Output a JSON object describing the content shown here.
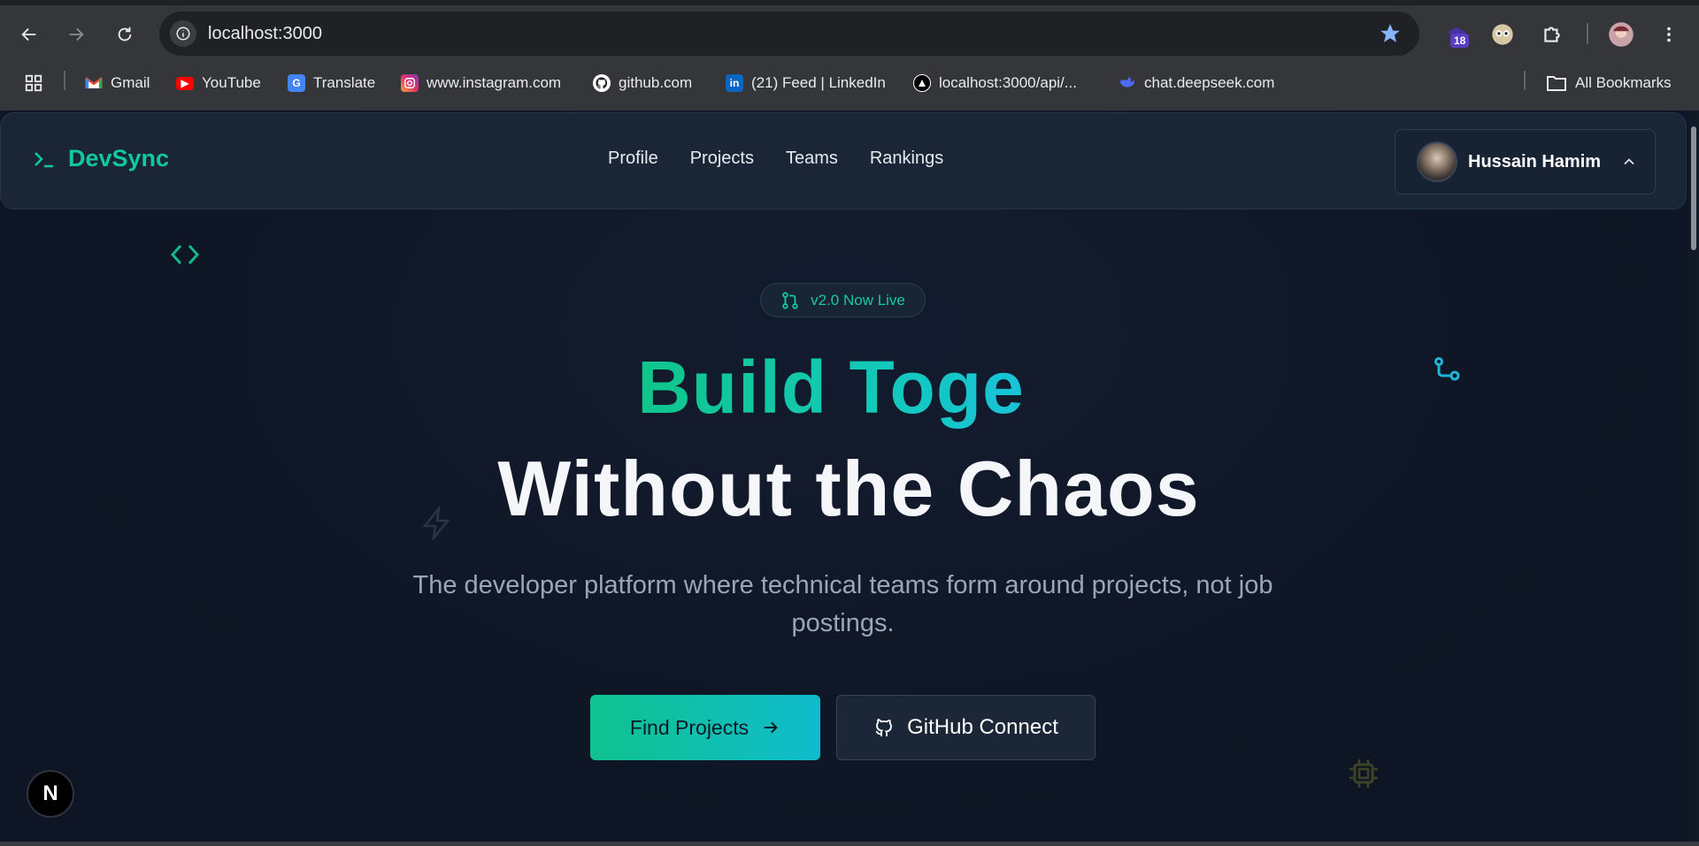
{
  "browser": {
    "url": "localhost:3000",
    "extension_badge": "18",
    "bookmarks": [
      {
        "label": "Gmail",
        "icon": "gmail-icon"
      },
      {
        "label": "YouTube",
        "icon": "youtube-icon"
      },
      {
        "label": "Translate",
        "icon": "translate-icon"
      },
      {
        "label": "www.instagram.com",
        "icon": "instagram-icon"
      },
      {
        "label": "github.com",
        "icon": "github-icon"
      },
      {
        "label": "(21) Feed | LinkedIn",
        "icon": "linkedin-icon"
      },
      {
        "label": "localhost:3000/api/...",
        "icon": "vercel-icon"
      },
      {
        "label": "chat.deepseek.com",
        "icon": "deepseek-icon"
      }
    ],
    "all_bookmarks": "All Bookmarks"
  },
  "header": {
    "logo_symbol": ">_",
    "brand": "DevSync",
    "nav": [
      "Profile",
      "Projects",
      "Teams",
      "Rankings"
    ],
    "user_name": "Hussain Hamim"
  },
  "hero": {
    "badge": "v2.0 Now Live",
    "title_line1": "Build Toge",
    "title_line2": "Without the Chaos",
    "subtitle": "The developer platform where technical teams form around projects, not job postings.",
    "primary_cta": "Find Projects",
    "secondary_cta": "GitHub Connect"
  },
  "overlay": {
    "nextjs_badge": "N"
  },
  "colors": {
    "accent": "#10c9a1",
    "accent_cyan": "#18c3d8",
    "background": "#0e1524",
    "header_bg": "#1a2536"
  }
}
